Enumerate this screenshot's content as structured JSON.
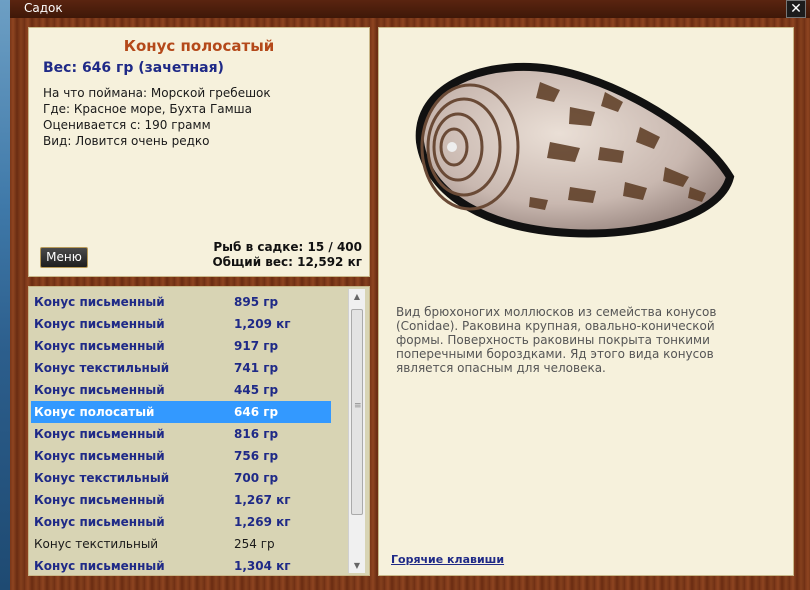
{
  "window": {
    "title": "Садок",
    "close_glyph": "✕"
  },
  "info": {
    "fish_name": "Конус полосатый",
    "weight": "Вес: 646 гр (зачетная)",
    "bait": "На что поймана: Морской гребешок",
    "location": "Где: Красное море, Бухта Гамша",
    "scored_from": "Оценивается с: 190 грамм",
    "kind": "Вид: Ловится очень редко",
    "menu_label": "Меню",
    "fish_count": "Рыб в садке: 15 / 400",
    "total_weight": "Общий вес: 12,592 кг"
  },
  "list": {
    "rows": [
      {
        "name": "Конус письменный",
        "weight": "895 гр",
        "style": "bold"
      },
      {
        "name": "Конус письменный",
        "weight": "1,209 кг",
        "style": "bold"
      },
      {
        "name": "Конус письменный",
        "weight": "917 гр",
        "style": "bold"
      },
      {
        "name": "Конус текстильный",
        "weight": "741 гр",
        "style": "bold"
      },
      {
        "name": "Конус письменный",
        "weight": "445 гр",
        "style": "bold"
      },
      {
        "name": "Конус полосатый",
        "weight": "646 гр",
        "style": "selected"
      },
      {
        "name": "Конус письменный",
        "weight": "816 гр",
        "style": "bold"
      },
      {
        "name": "Конус письменный",
        "weight": "756 гр",
        "style": "bold"
      },
      {
        "name": "Конус текстильный",
        "weight": "700 гр",
        "style": "bold"
      },
      {
        "name": "Конус письменный",
        "weight": "1,267 кг",
        "style": "bold"
      },
      {
        "name": "Конус письменный",
        "weight": "1,269 кг",
        "style": "bold"
      },
      {
        "name": "Конус текстильный",
        "weight": "254 гр",
        "style": "plain"
      },
      {
        "name": "Конус письменный",
        "weight": "1,304 кг",
        "style": "bold"
      }
    ]
  },
  "detail": {
    "description": "Вид брюхоногих моллюсков из семейства конусов (Conidae). Раковина крупная, овально-конической формы. Поверхность раковины покрыта тонкими поперечными бороздками. Яд этого вида конусов является опасным для человека.",
    "hotkeys_label": "Горячие клавиши"
  },
  "colors": {
    "accent_title": "#b4491a",
    "accent_bold": "#1f2a87",
    "selection": "#3399ff"
  }
}
